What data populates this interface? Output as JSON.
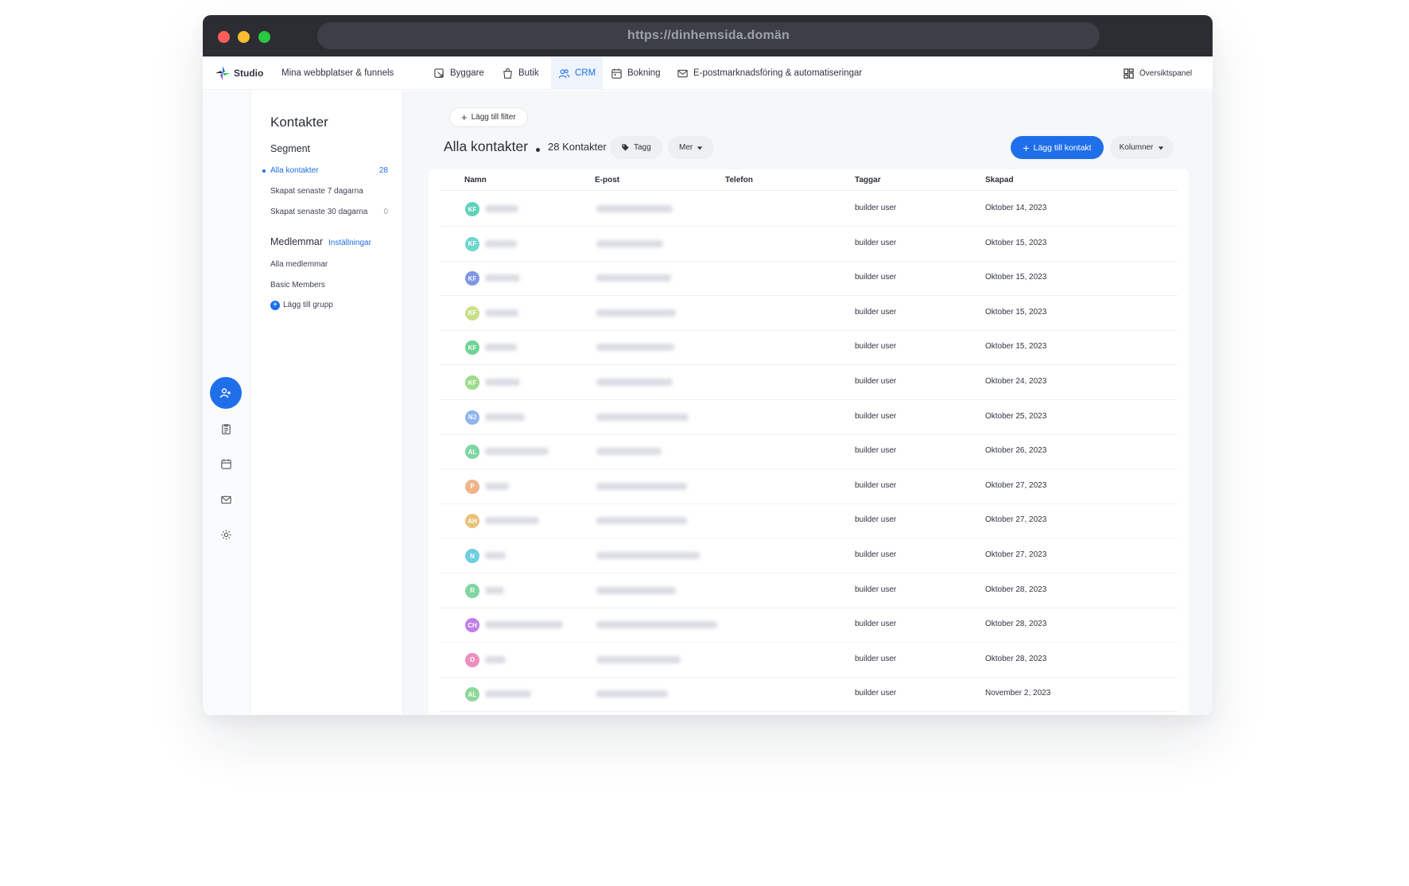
{
  "browser": {
    "url": "https://dinhemsida.domän"
  },
  "topnav": {
    "brand": "Studio",
    "sites": "Mina webbplatser & funnels",
    "items": [
      {
        "label": "Byggare",
        "icon": "builder-icon"
      },
      {
        "label": "Butik",
        "icon": "shopping-bag-icon"
      },
      {
        "label": "CRM",
        "icon": "users-icon"
      },
      {
        "label": "Bokning",
        "icon": "calendar-icon"
      },
      {
        "label": "E-postmarknadsföring & automatiseringar",
        "icon": "mail-icon"
      }
    ],
    "dashboard": "Översiktspanel"
  },
  "sidebar": {
    "title": "Kontakter",
    "segment_heading": "Segment",
    "segments": [
      {
        "label": "Alla kontakter",
        "count": "28"
      },
      {
        "label": "Skapat senaste 7 dagarna",
        "count": ""
      },
      {
        "label": "Skapat senaste 30 dagarna",
        "count": "0"
      }
    ],
    "members_heading": "Medlemmar",
    "members_settings": "Inställningar",
    "members": [
      "Alla medlemmar",
      "Basic Members"
    ],
    "add_group": "Lägg till grupp"
  },
  "toolbar": {
    "add_filter": "Lägg till filter",
    "title": "Alla kontakter",
    "count": "28 Kontakter",
    "tag": "Tagg",
    "more": "Mer",
    "add_contact": "Lägg till kontakt",
    "columns": "Kolumner"
  },
  "table": {
    "headers": {
      "name": "Namn",
      "email": "E-post",
      "phone": "Telefon",
      "tags": "Taggar",
      "created": "Skapad"
    },
    "rows": [
      {
        "initials": "KF",
        "color": "#5fd3b8",
        "tag": "builder user",
        "created": "Oktober 14, 2023"
      },
      {
        "initials": "KF",
        "color": "#6fd6cf",
        "tag": "builder user",
        "created": "Oktober 15, 2023"
      },
      {
        "initials": "KF",
        "color": "#7e95e8",
        "tag": "builder user",
        "created": "Oktober 15, 2023"
      },
      {
        "initials": "KF",
        "color": "#c9e08a",
        "tag": "builder user",
        "created": "Oktober 15, 2023"
      },
      {
        "initials": "KF",
        "color": "#6fd493",
        "tag": "builder user",
        "created": "Oktober 15, 2023"
      },
      {
        "initials": "KF",
        "color": "#9fdc8a",
        "tag": "builder user",
        "created": "Oktober 24, 2023"
      },
      {
        "initials": "NJ",
        "color": "#8fb3ef",
        "tag": "builder user",
        "created": "Oktober 25, 2023"
      },
      {
        "initials": "AL",
        "color": "#7fd6a2",
        "tag": "builder user",
        "created": "Oktober 26, 2023"
      },
      {
        "initials": "P",
        "color": "#f0b48a",
        "tag": "builder user",
        "created": "Oktober 27, 2023"
      },
      {
        "initials": "AH",
        "color": "#e8c27a",
        "tag": "builder user",
        "created": "Oktober 27, 2023"
      },
      {
        "initials": "N",
        "color": "#6fcde0",
        "tag": "builder user",
        "created": "Oktober 27, 2023"
      },
      {
        "initials": "R",
        "color": "#7fd6a2",
        "tag": "builder user",
        "created": "Oktober 28, 2023"
      },
      {
        "initials": "CH",
        "color": "#c07ee8",
        "tag": "builder user",
        "created": "Oktober 28, 2023"
      },
      {
        "initials": "O",
        "color": "#ec8fbf",
        "tag": "builder user",
        "created": "Oktober 28, 2023"
      },
      {
        "initials": "AL",
        "color": "#8fd89a",
        "tag": "builder user",
        "created": "November 2, 2023"
      }
    ]
  },
  "colors": {
    "accent": "#1f6feb",
    "titlebar": "#2b2d33"
  }
}
